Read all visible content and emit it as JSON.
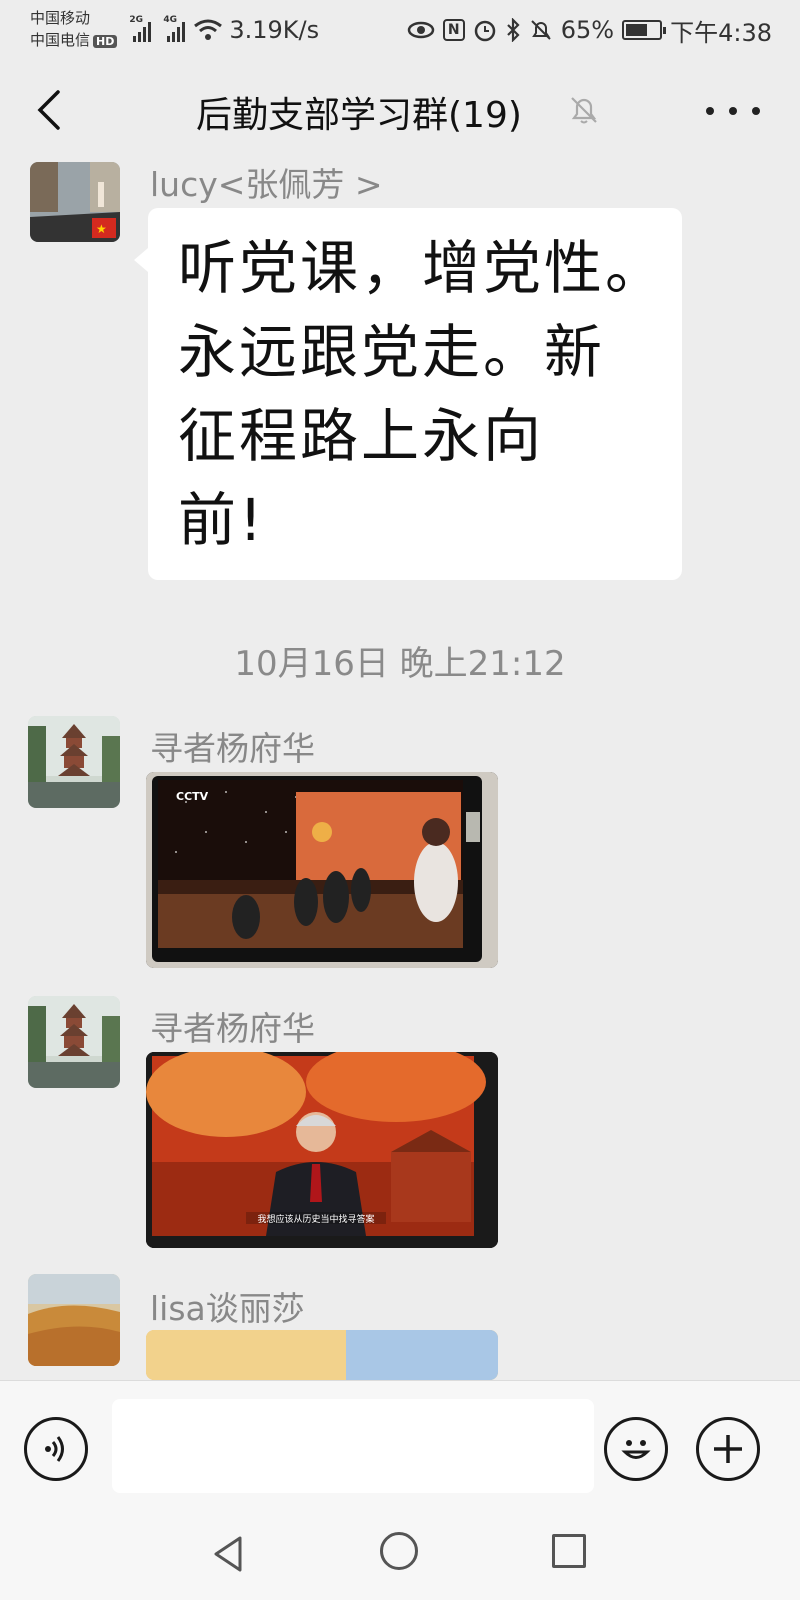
{
  "status_bar": {
    "carrier_1": "中国移动",
    "carrier_2": "中国电信",
    "hd_badge": "HD",
    "net_gen_1": "2G",
    "net_gen_2": "4G",
    "speed": "3.19K/s",
    "nfc": "N",
    "battery": "65%",
    "battery_level": 0.65,
    "time": "下午4:38"
  },
  "header": {
    "title": "后勤支部学习群(19)"
  },
  "messages": [
    {
      "sender": "lucy<张佩芳 >",
      "type": "text",
      "lines": [
        "听党课，增党性。",
        "永远跟党走。新",
        "征程路上永向",
        "前!"
      ]
    },
    {
      "sender": "寻者杨府华",
      "type": "image",
      "image_desc": "tv-screen-party-lecture-audience"
    },
    {
      "sender": "寻者杨府华",
      "type": "image",
      "image_desc": "tv-screen-speaker-red-background",
      "subtitle": "我想应该从历史当中找寻答案"
    },
    {
      "sender": "lisa谈丽莎",
      "type": "image",
      "image_desc": "partial-image"
    }
  ],
  "timestamp": "10月16日 晚上21:12",
  "tv_logo": "CCTV",
  "input_bar": {
    "value": "",
    "placeholder": ""
  },
  "icons": {
    "back": "chevron-left-icon",
    "mute": "bell-off-icon",
    "more": "more-dots-icon",
    "voice": "voice-icon",
    "emoji": "emoji-icon",
    "plus": "plus-icon"
  }
}
